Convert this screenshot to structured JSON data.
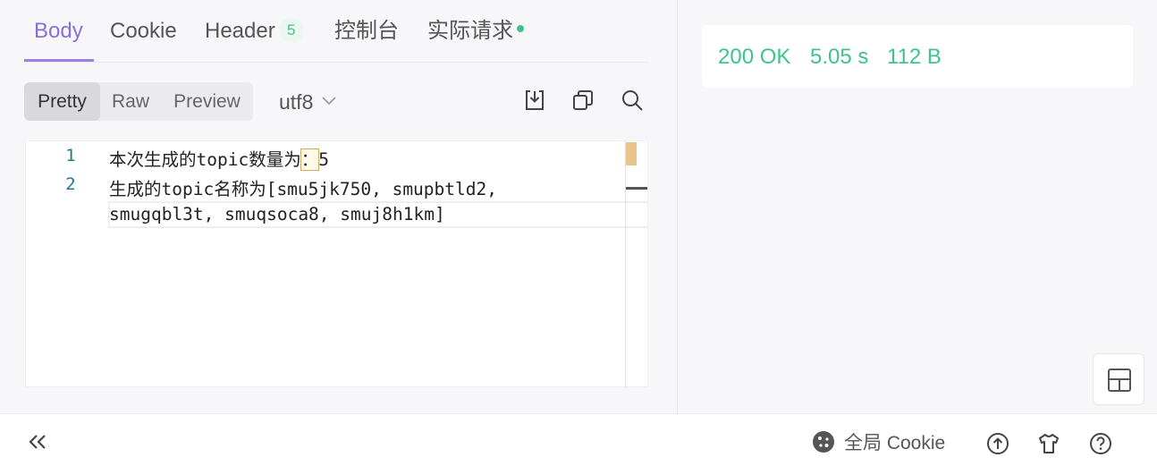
{
  "response_tabs": [
    {
      "label": "Body",
      "active": true
    },
    {
      "label": "Cookie"
    },
    {
      "label": "Header",
      "badge": "5"
    },
    {
      "label": "控制台"
    },
    {
      "label": "实际请求",
      "status_dot_color": "#3ec38b"
    }
  ],
  "view_modes": [
    "Pretty",
    "Raw",
    "Preview"
  ],
  "active_view_mode": "Pretty",
  "encoding": "utf8",
  "toolbar_icons": [
    "download-icon",
    "copy-icon",
    "search-icon"
  ],
  "editor": {
    "line_numbers": [
      "1",
      "2"
    ],
    "line1_prefix": "本次生成的topic数量为",
    "line1_highlight": "：",
    "line1_suffix": "5",
    "line2_a": "生成的topic名称为[smu5jk750, smupbtld2,",
    "line2_b": "smugqbl3t, smuqsoca8, smuj8h1km]"
  },
  "summary": {
    "status": "200 OK",
    "time": "5.05 s",
    "size": "112 B",
    "color": "#3ec38b"
  },
  "bottom_bar": {
    "collapse_icon": "double-chevron-left-icon",
    "cookie_label": "全局 Cookie",
    "icons": [
      "upload-circle-icon",
      "shirt-icon",
      "help-circle-icon"
    ]
  },
  "colors": {
    "accent": "#8b6fd9",
    "success": "#3ec38b"
  }
}
